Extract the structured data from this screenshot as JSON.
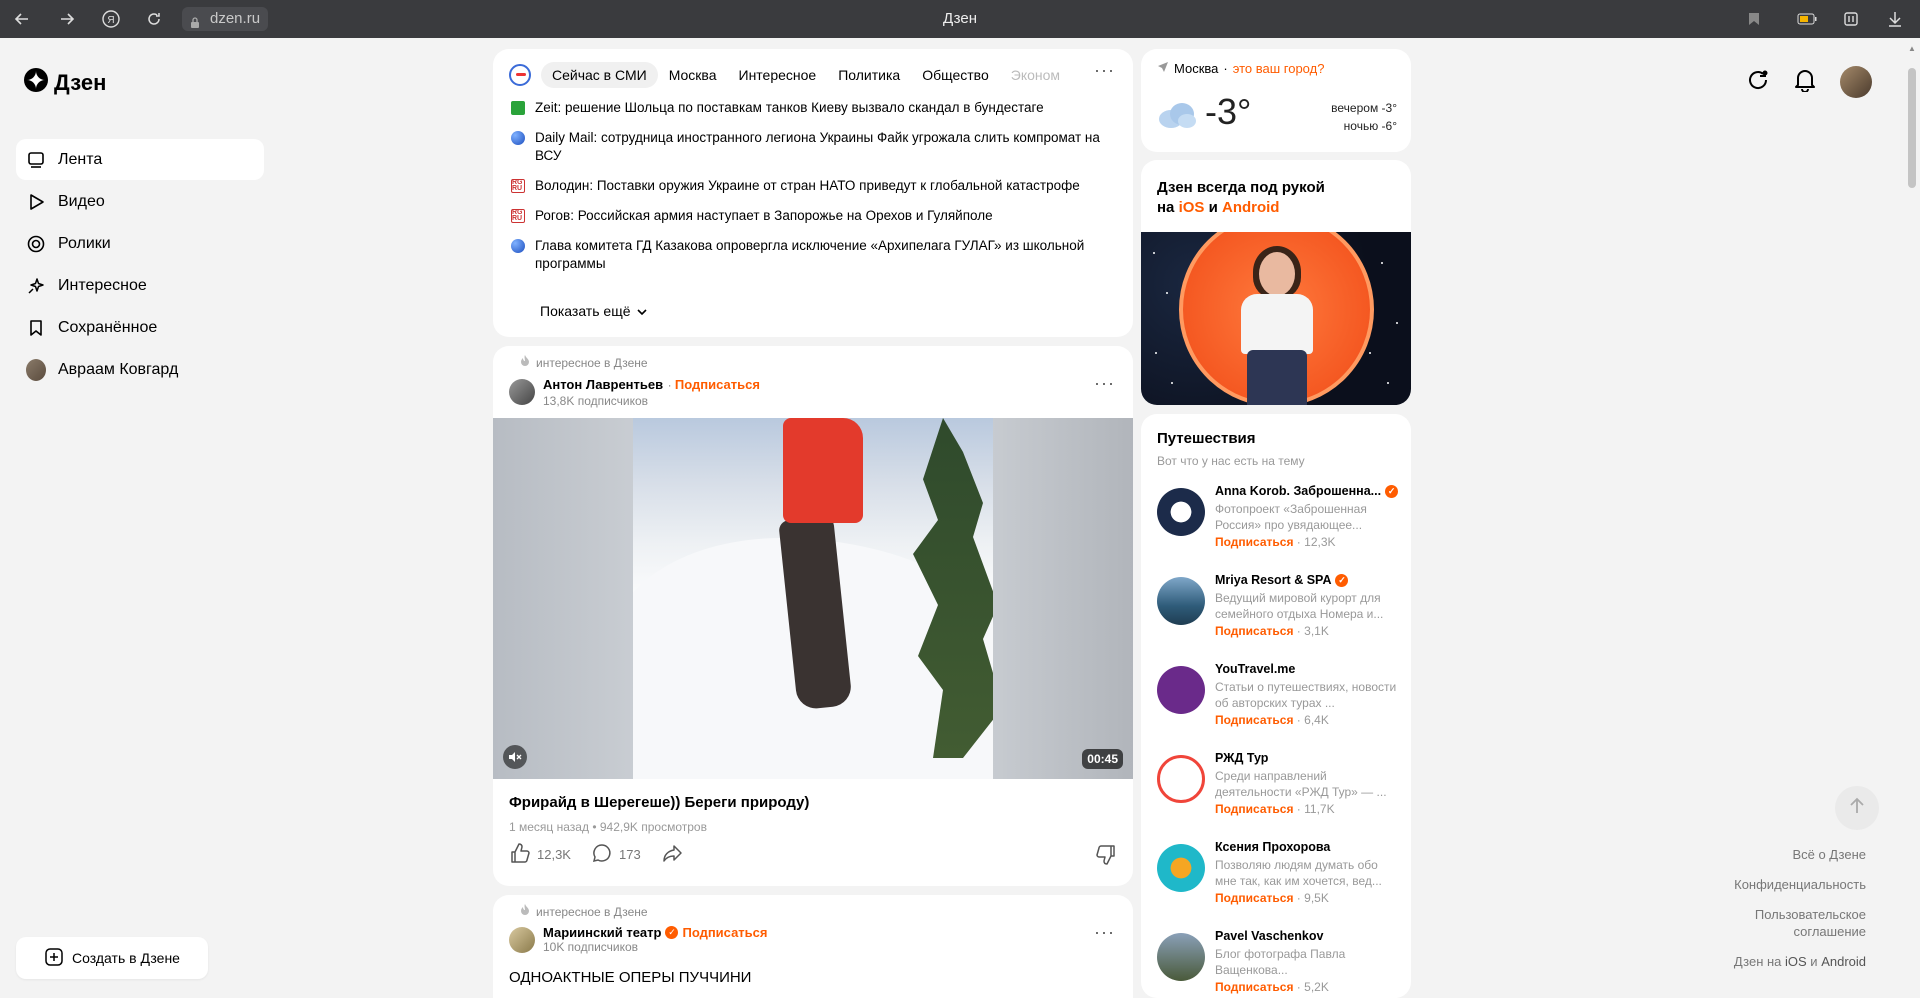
{
  "browser": {
    "url": "dzen.ru",
    "title": "Дзен"
  },
  "sidebar": {
    "logo": "Дзен",
    "items": [
      {
        "label": "Лента",
        "icon": "feed-icon",
        "active": true
      },
      {
        "label": "Видео",
        "icon": "play-icon"
      },
      {
        "label": "Ролики",
        "icon": "shorts-icon"
      },
      {
        "label": "Интересное",
        "icon": "sparkle-icon"
      },
      {
        "label": "Сохранённое",
        "icon": "bookmark-icon"
      },
      {
        "label": "Авраам Ковгард",
        "icon": "avatar"
      }
    ],
    "create_label": "Создать в Дзене"
  },
  "news": {
    "tabs": [
      "Сейчас в СМИ",
      "Москва",
      "Интересное",
      "Политика",
      "Общество",
      "Эконом"
    ],
    "items": [
      {
        "source_icon": "ret",
        "text": "Zeit: решение Шольца по поставкам танков Киеву вызвало скандал в бундестаге"
      },
      {
        "source_icon": "globe",
        "text": "Daily Mail: сотрудница иностранного легиона Украины Файк угрожала слить компромат на ВСУ"
      },
      {
        "source_icon": "rg",
        "text": "Володин: Поставки оружия Украине от стран НАТО приведут к глобальной катастрофе"
      },
      {
        "source_icon": "rg",
        "text": "Рогов: Российская армия наступает в Запорожье на Орехов и Гуляйполе"
      },
      {
        "source_icon": "globe",
        "text": "Глава комитета ГД Казакова опровергла исключение «Архипелага ГУЛАГ» из школьной программы"
      }
    ],
    "show_more": "Показать ещё"
  },
  "post1": {
    "badge": "интересное в Дзене",
    "author": "Антон Лаврентьев",
    "subscribe": "Подписаться",
    "subscribers": "13,8K подписчиков",
    "duration": "00:45",
    "title": "Фрирайд в Шерегеше)) Береги природу)",
    "stats": "1 месяц назад • 942,9K просмотров",
    "likes": "12,3K",
    "comments": "173"
  },
  "post2": {
    "badge": "интересное в Дзене",
    "author": "Мариинский театр",
    "subscribe": "Подписаться",
    "subscribers": "10K подписчиков",
    "title": "ОДНОАКТНЫЕ ОПЕРЫ ПУЧЧИНИ"
  },
  "weather": {
    "city": "Москва",
    "question": "это ваш город?",
    "temp": "-3°",
    "evening": "вечером -3°",
    "night": "ночью -6°"
  },
  "promo": {
    "line1": "Дзен всегда под рукой",
    "line2_prefix": "на ",
    "ios": "iOS",
    "and": " и ",
    "android": "Android"
  },
  "travel": {
    "title": "Путешествия",
    "subtitle": "Вот что у нас есть на тему",
    "channels": [
      {
        "name": "Anna Korob. Заброшенна...",
        "verified": true,
        "desc": "Фотопроект «Заброшенная Россия» про увядающее...",
        "subscribe": "Подписаться",
        "count": "12,3K",
        "color": "#1c2b4a"
      },
      {
        "name": "Mriya Resort & SPA",
        "verified": true,
        "desc": "Ведущий мировой курорт для семейного отдыха Номера и...",
        "subscribe": "Подписаться",
        "count": "3,1K",
        "color": "#2f5c7a"
      },
      {
        "name": "YouTravel.me",
        "verified": false,
        "desc": "Статьи о путешествиях, новости об авторских турах ...",
        "subscribe": "Подписаться",
        "count": "6,4K",
        "color": "#6a2a8a"
      },
      {
        "name": "РЖД Тур",
        "verified": false,
        "desc": "Среди направлений деятельности «РЖД Тур» — ...",
        "subscribe": "Подписаться",
        "count": "11,7K",
        "color": "#f0453a"
      },
      {
        "name": "Ксения Прохорова",
        "verified": false,
        "desc": "Позволяю людям думать обо мне так, как им хочется, вед...",
        "subscribe": "Подписаться",
        "count": "9,5K",
        "color": "#1fb8c9"
      },
      {
        "name": "Pavel Vaschenkov",
        "verified": false,
        "desc": "Блог фотографа Павла Ващенкова...",
        "subscribe": "Подписаться",
        "count": "5,2K",
        "color": "#4a5a3a"
      }
    ]
  },
  "footer": {
    "about": "Всё о Дзене",
    "privacy": "Конфиденциальность",
    "terms": "Пользовательское соглашение",
    "apps_prefix": "Дзен на ",
    "apps_ios": "iOS",
    "apps_and": " и ",
    "apps_android": "Android"
  }
}
